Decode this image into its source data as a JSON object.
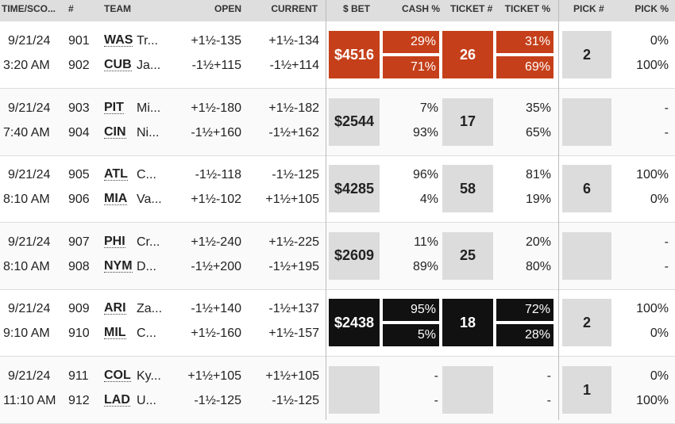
{
  "header": {
    "time": "TIME/SCO...",
    "num": "#",
    "team": "TEAM",
    "open": "OPEN",
    "current": "CURRENT",
    "bet": "$ BET",
    "cash": "CASH %",
    "ticket_num": "TICKET #",
    "ticket_pct": "TICKET %",
    "pick_num": "PICK #",
    "pick_pct": "PICK %"
  },
  "colors": {
    "orange": "#c5401a",
    "black": "#111111",
    "grey_box": "#dcdcdc"
  },
  "rows": [
    {
      "highlight": "orange",
      "date": "9/21/24",
      "time": "3:20 AM",
      "nums": [
        "901",
        "902"
      ],
      "teams": [
        "WAS",
        "CUB"
      ],
      "names": [
        "Tr...",
        "Ja..."
      ],
      "open": [
        "+1½-135",
        "-1½+115"
      ],
      "current": [
        "+1½-134",
        "-1½+114"
      ],
      "bet": "$4516",
      "cash": [
        "29%",
        "71%"
      ],
      "ticket_num": "26",
      "ticket_pct": [
        "31%",
        "69%"
      ],
      "pick_num": "2",
      "pick_pct": [
        "0%",
        "100%"
      ]
    },
    {
      "highlight": "none",
      "date": "9/21/24",
      "time": "7:40 AM",
      "nums": [
        "903",
        "904"
      ],
      "teams": [
        "PIT",
        "CIN"
      ],
      "names": [
        "Mi...",
        "Ni..."
      ],
      "open": [
        "+1½-180",
        "-1½+160"
      ],
      "current": [
        "+1½-182",
        "-1½+162"
      ],
      "bet": "$2544",
      "cash": [
        "7%",
        "93%"
      ],
      "ticket_num": "17",
      "ticket_pct": [
        "35%",
        "65%"
      ],
      "pick_num": "",
      "pick_pct": [
        "-",
        "-"
      ]
    },
    {
      "highlight": "none",
      "date": "9/21/24",
      "time": "8:10 AM",
      "nums": [
        "905",
        "906"
      ],
      "teams": [
        "ATL",
        "MIA"
      ],
      "names": [
        "C...",
        "Va..."
      ],
      "open": [
        "-1½-118",
        "+1½-102"
      ],
      "current": [
        "-1½-125",
        "+1½+105"
      ],
      "bet": "$4285",
      "cash": [
        "96%",
        "4%"
      ],
      "ticket_num": "58",
      "ticket_pct": [
        "81%",
        "19%"
      ],
      "pick_num": "6",
      "pick_pct": [
        "100%",
        "0%"
      ]
    },
    {
      "highlight": "none",
      "date": "9/21/24",
      "time": "8:10 AM",
      "nums": [
        "907",
        "908"
      ],
      "teams": [
        "PHI",
        "NYM"
      ],
      "names": [
        "Cr...",
        "D..."
      ],
      "open": [
        "+1½-240",
        "-1½+200"
      ],
      "current": [
        "+1½-225",
        "-1½+195"
      ],
      "bet": "$2609",
      "cash": [
        "11%",
        "89%"
      ],
      "ticket_num": "25",
      "ticket_pct": [
        "20%",
        "80%"
      ],
      "pick_num": "",
      "pick_pct": [
        "-",
        "-"
      ]
    },
    {
      "highlight": "black",
      "date": "9/21/24",
      "time": "9:10 AM",
      "nums": [
        "909",
        "910"
      ],
      "teams": [
        "ARI",
        "MIL"
      ],
      "names": [
        "Za...",
        "C..."
      ],
      "open": [
        "-1½+140",
        "+1½-160"
      ],
      "current": [
        "-1½+137",
        "+1½-157"
      ],
      "bet": "$2438",
      "cash": [
        "95%",
        "5%"
      ],
      "ticket_num": "18",
      "ticket_pct": [
        "72%",
        "28%"
      ],
      "pick_num": "2",
      "pick_pct": [
        "100%",
        "0%"
      ]
    },
    {
      "highlight": "none",
      "date": "9/21/24",
      "time": "11:10 AM",
      "nums": [
        "911",
        "912"
      ],
      "teams": [
        "COL",
        "LAD"
      ],
      "names": [
        "Ky...",
        "U..."
      ],
      "open": [
        "+1½+105",
        "-1½-125"
      ],
      "current": [
        "+1½+105",
        "-1½-125"
      ],
      "bet": "",
      "cash": [
        "-",
        "-"
      ],
      "ticket_num": "",
      "ticket_pct": [
        "-",
        "-"
      ],
      "pick_num": "1",
      "pick_pct": [
        "0%",
        "100%"
      ]
    }
  ]
}
